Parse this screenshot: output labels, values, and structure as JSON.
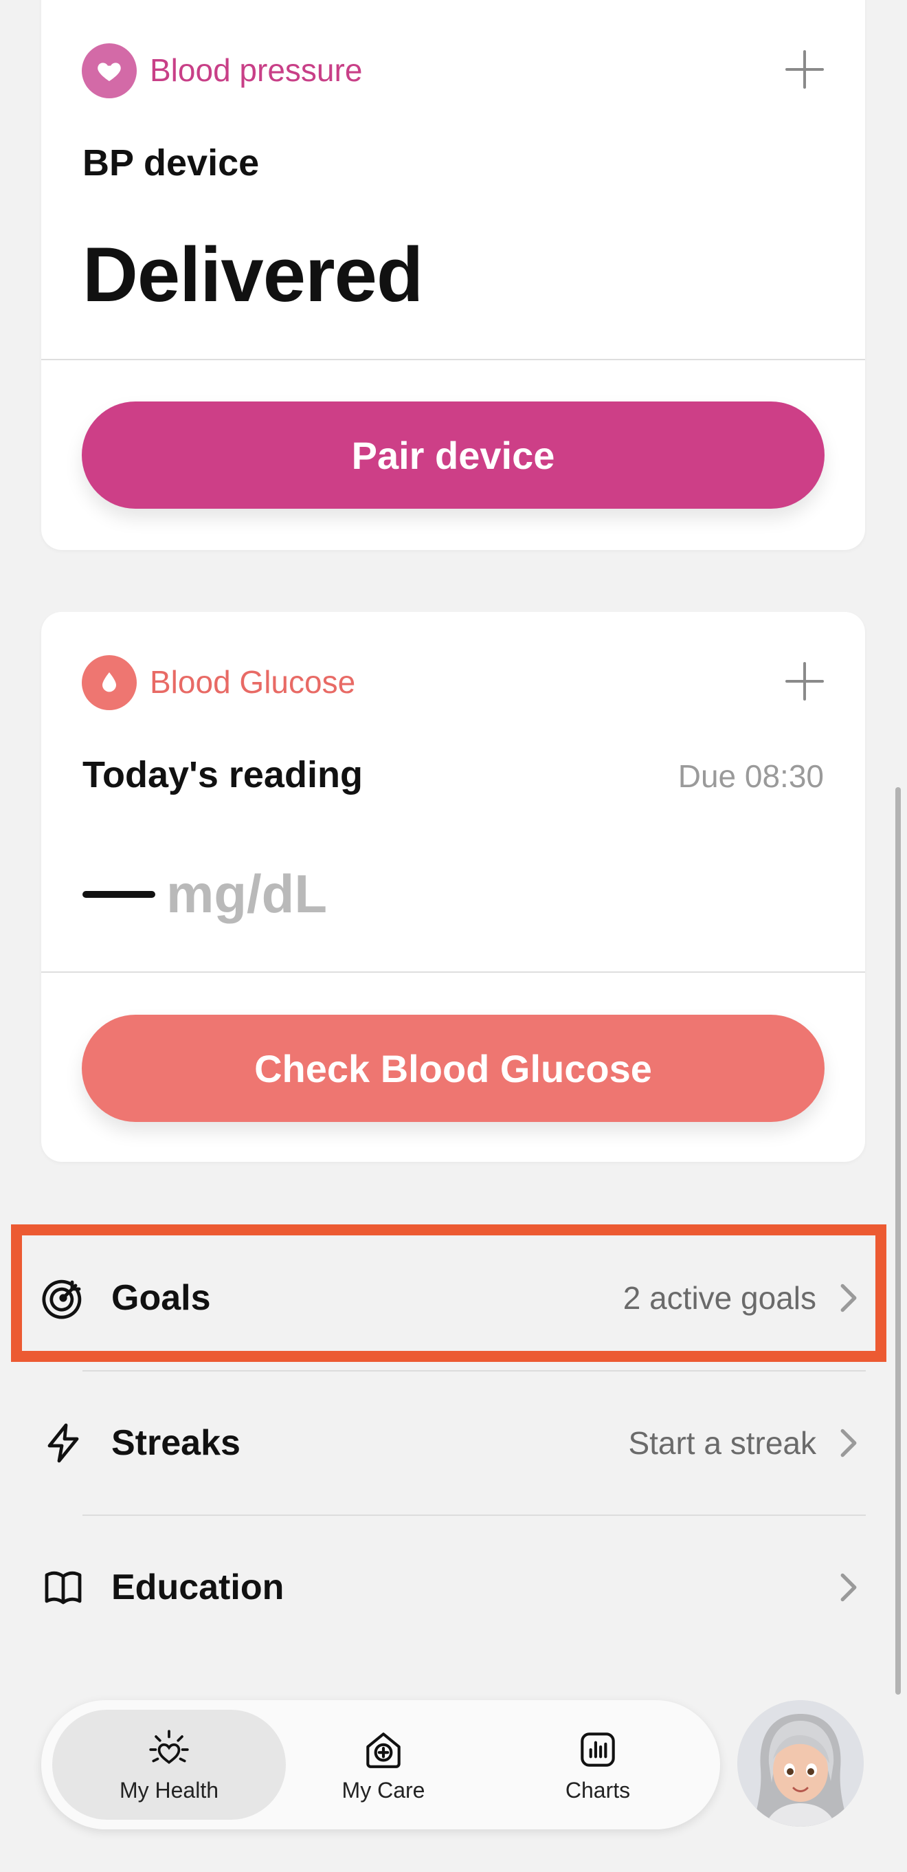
{
  "blood_pressure": {
    "label": "Blood pressure",
    "device": "BP device",
    "status": "Delivered",
    "button": "Pair device",
    "accent": "#cd3f87",
    "badge_color": "#d36aa7"
  },
  "blood_glucose": {
    "label": "Blood Glucose",
    "subtitle": "Today's reading",
    "due": "Due 08:30",
    "unit": "mg/dL",
    "button": "Check Blood Glucose",
    "accent": "#ee7671"
  },
  "list": [
    {
      "title": "Goals",
      "meta": "2 active goals",
      "icon": "target-icon"
    },
    {
      "title": "Streaks",
      "meta": "Start a streak",
      "icon": "lightning-icon"
    },
    {
      "title": "Education",
      "meta": "",
      "icon": "book-icon"
    }
  ],
  "highlight_color": "#ec5a32",
  "nav": [
    {
      "label": "My Health",
      "icon": "heart-sun-icon",
      "active": true
    },
    {
      "label": "My Care",
      "icon": "house-plus-icon",
      "active": false
    },
    {
      "label": "Charts",
      "icon": "bar-chart-icon",
      "active": false
    }
  ]
}
